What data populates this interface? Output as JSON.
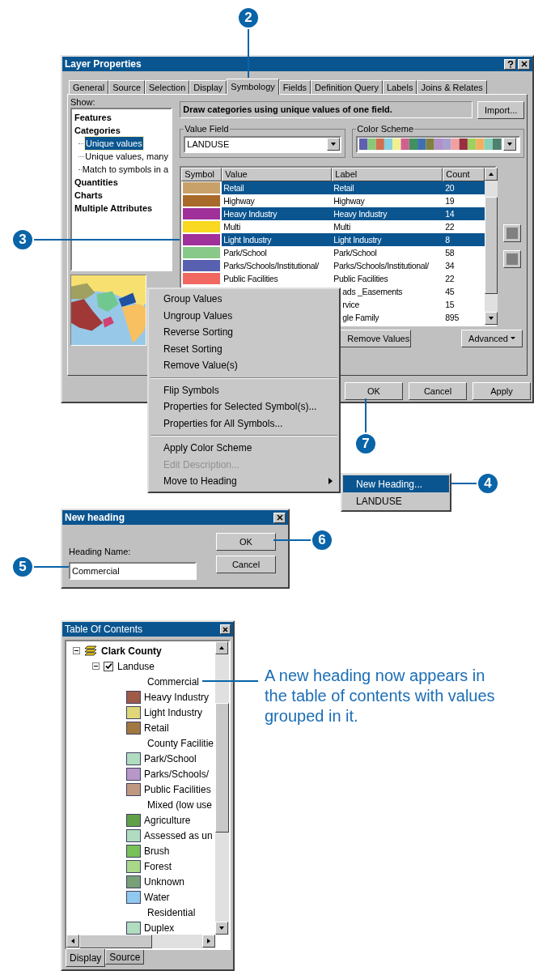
{
  "callouts": [
    {
      "number": "2"
    },
    {
      "number": "3"
    },
    {
      "number": "7"
    },
    {
      "number": "4"
    },
    {
      "number": "5"
    },
    {
      "number": "6"
    }
  ],
  "layer_properties": {
    "title": "Layer Properties",
    "tabs": [
      {
        "label": "General",
        "selected": false
      },
      {
        "label": "Source",
        "selected": false
      },
      {
        "label": "Selection",
        "selected": false
      },
      {
        "label": "Display",
        "selected": false
      },
      {
        "label": "Symbology",
        "selected": true
      },
      {
        "label": "Fields",
        "selected": false
      },
      {
        "label": "Definition Query",
        "selected": false
      },
      {
        "label": "Labels",
        "selected": false
      },
      {
        "label": "Joins & Relates",
        "selected": false
      }
    ],
    "show_label": "Show:",
    "show_tree": [
      {
        "label": "Features",
        "selected": false
      },
      {
        "label": "Categories",
        "selected": false,
        "children": [
          {
            "label": "Unique values",
            "selected": true
          },
          {
            "label": "Unique values, many",
            "selected": false
          },
          {
            "label": "Match to symbols in a",
            "selected": false
          }
        ]
      },
      {
        "label": "Quantities",
        "selected": false
      },
      {
        "label": "Charts",
        "selected": false
      },
      {
        "label": "Multiple Attributes",
        "selected": false
      }
    ],
    "description": "Draw categories using unique values of one field.",
    "import_button": "Import...",
    "value_field": {
      "legend": "Value Field",
      "value": "LANDUSE"
    },
    "color_scheme": {
      "legend": "Color Scheme"
    },
    "table": {
      "columns": [
        "Symbol",
        "Value",
        "Label",
        "Count"
      ],
      "rows": [
        {
          "color": "#c8a06a",
          "value": "Retail",
          "label": "Retail",
          "count": "20",
          "selected": true
        },
        {
          "color": "#a86a28",
          "value": "Highway",
          "label": "Highway",
          "count": "19",
          "selected": false
        },
        {
          "color": "#a0309a",
          "value": "Heavy Industry",
          "label": "Heavy Industry",
          "count": "14",
          "selected": true
        },
        {
          "color": "#f8d820",
          "value": "Multi",
          "label": "Multi",
          "count": "22",
          "selected": false
        },
        {
          "color": "#a0309a",
          "value": "Light Industry",
          "label": "Light Industry",
          "count": "8",
          "selected": true
        },
        {
          "color": "#88c888",
          "value": "Park/School",
          "label": "Park/School",
          "count": "58",
          "selected": false
        },
        {
          "color": "#5860b0",
          "value": "Parks/Schools/Institutional/",
          "label": "Parks/Schools/Institutional/",
          "count": "34",
          "selected": false
        },
        {
          "color": "#f06860",
          "value": "Public Facilities",
          "label": "Public Facilities",
          "count": "22",
          "selected": false
        },
        {
          "label": "ads _Easements",
          "count": "45",
          "selected": false
        },
        {
          "label": "rvice",
          "count": "15",
          "selected": false
        },
        {
          "label": "gle Family",
          "count": "895",
          "selected": false
        }
      ]
    },
    "remove_button": "Remove Values",
    "advanced_button": "Advanced",
    "footer_buttons": [
      "OK",
      "Cancel",
      "Apply"
    ]
  },
  "context_menu": {
    "items": [
      {
        "kind": "item",
        "label": "Group Values",
        "disabled": false
      },
      {
        "kind": "item",
        "label": "Ungroup Values",
        "disabled": false
      },
      {
        "kind": "item",
        "label": "Reverse Sorting",
        "disabled": false
      },
      {
        "kind": "item",
        "label": "Reset Sorting",
        "disabled": false
      },
      {
        "kind": "item",
        "label": "Remove Value(s)",
        "disabled": false
      },
      {
        "kind": "separator"
      },
      {
        "kind": "item",
        "label": "Flip Symbols",
        "disabled": false
      },
      {
        "kind": "item",
        "label": "Properties for Selected Symbol(s)...",
        "disabled": false
      },
      {
        "kind": "item",
        "label": "Properties for All Symbols...",
        "disabled": false
      },
      {
        "kind": "separator"
      },
      {
        "kind": "item",
        "label": "Apply Color Scheme",
        "disabled": false
      },
      {
        "kind": "item",
        "label": "Edit Description...",
        "disabled": true
      },
      {
        "kind": "submenu",
        "label": "Move to Heading",
        "disabled": false
      }
    ],
    "submenu": [
      {
        "label": "New Heading...",
        "selected": true
      },
      {
        "label": "LANDUSE",
        "selected": false
      }
    ]
  },
  "new_heading_dialog": {
    "title": "New heading",
    "field_label": "Heading Name:",
    "value": "Commercial",
    "buttons": [
      "OK",
      "Cancel"
    ]
  },
  "table_of_contents": {
    "title": "Table Of Contents",
    "tree": [
      {
        "label": "Clark County",
        "expanded": true,
        "children": [
          {
            "label": "Landuse",
            "checked": true,
            "expanded": true,
            "legend": [
              {
                "kind": "heading",
                "label": "Commercial"
              },
              {
                "kind": "class",
                "label": "Heavy Industry",
                "color": "#a05a48"
              },
              {
                "kind": "class",
                "label": "Light Industry",
                "color": "#e0d878"
              },
              {
                "kind": "class",
                "label": "Retail",
                "color": "#a07840"
              },
              {
                "kind": "heading",
                "label": "County Facilitie"
              },
              {
                "kind": "class",
                "label": "Park/School",
                "color": "#b0dcc0"
              },
              {
                "kind": "class",
                "label": "Parks/Schools/",
                "color": "#b898c8"
              },
              {
                "kind": "class",
                "label": "Public Facilities",
                "color": "#c09880"
              },
              {
                "kind": "heading",
                "label": "Mixed (low use"
              },
              {
                "kind": "class",
                "label": "Agriculture",
                "color": "#60a048"
              },
              {
                "kind": "class",
                "label": "Assessed as un",
                "color": "#b0dcc0"
              },
              {
                "kind": "class",
                "label": "Brush",
                "color": "#78c058"
              },
              {
                "kind": "class",
                "label": "Forest",
                "color": "#a8d888"
              },
              {
                "kind": "class",
                "label": "Unknown",
                "color": "#78a078"
              },
              {
                "kind": "class",
                "label": "Water",
                "color": "#90c8f0"
              },
              {
                "kind": "heading",
                "label": "Residential"
              },
              {
                "kind": "class",
                "label": "Duplex",
                "color": "#b0dcc0"
              }
            ]
          }
        ]
      }
    ],
    "tabs": [
      {
        "label": "Display",
        "selected": true
      },
      {
        "label": "Source",
        "selected": false
      }
    ]
  },
  "caption": "A new heading now appears in the table of contents with values grouped in it."
}
